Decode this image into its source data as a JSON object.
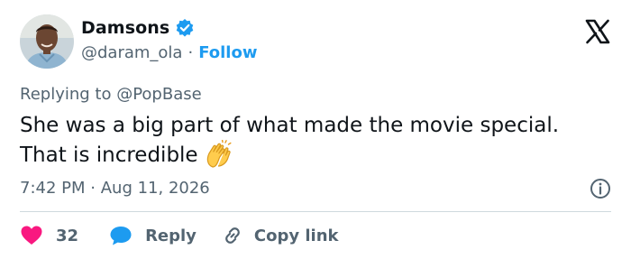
{
  "author": {
    "display_name": "Damsons",
    "handle": "@daram_ola",
    "separator": "·",
    "follow_label": "Follow",
    "verified_color": "#1d9bf0"
  },
  "reply_context": "Replying to @PopBase",
  "tweet": {
    "text": "She was a big part of what made the movie special. That is incredible",
    "emoji": "clapping-hands"
  },
  "meta": {
    "time": "7:42 PM",
    "separator": "·",
    "date": "Aug 11, 2026"
  },
  "actions": {
    "like_count": "32",
    "reply_label": "Reply",
    "copy_label": "Copy link"
  },
  "colors": {
    "accent": "#1d9bf0",
    "like": "#f91880",
    "text": "#0f1419",
    "muted": "#536471"
  },
  "icons": [
    "verified-badge-icon",
    "x-logo-icon",
    "info-icon",
    "heart-icon",
    "reply-bubble-icon",
    "link-icon",
    "clap-emoji-icon"
  ]
}
